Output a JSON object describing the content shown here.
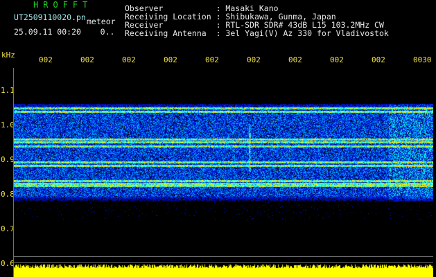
{
  "header": {
    "brand": "HROFFT",
    "filename": "UT2509110020.pn",
    "mode": "meteor",
    "datetime": "25.09.11 00:20",
    "extra": "0..",
    "info_rows": [
      {
        "label": "Observer",
        "value": "Masaki Kano"
      },
      {
        "label": "Receiving Location",
        "value": "Shibukawa, Gunma, Japan"
      },
      {
        "label": "Receiver",
        "value": "RTL-SDR SDR# 43dB L15 103.2MHz CW"
      },
      {
        "label": "Receiving Antenna",
        "value": "3el Yagi(V) Az 330 for Vladivostok"
      }
    ]
  },
  "axis": {
    "unit": "kHz",
    "time_ticks": [
      "002",
      "002",
      "002",
      "002",
      "002",
      "002",
      "002",
      "002",
      "002",
      "0030"
    ],
    "freq_ticks": [
      "1.1",
      "1.0",
      "0.9",
      "0.8",
      "0.7",
      "0.6"
    ]
  },
  "colors": {
    "background": "#000000",
    "header_green": "#22d322",
    "header_cyan": "#9fe8e8",
    "axis_yellow": "#f2e14a",
    "noise_bar": "#ffff00"
  }
}
